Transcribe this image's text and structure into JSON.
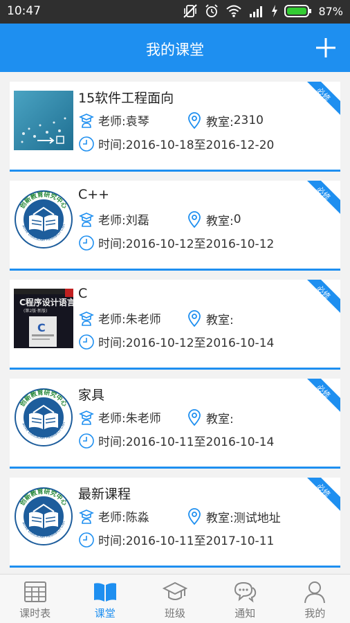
{
  "status_bar": {
    "time": "10:47",
    "battery": "87%"
  },
  "header": {
    "title": "我的课堂",
    "add_icon": "plus-icon"
  },
  "labels": {
    "teacher": "老师: ",
    "room": "教室: ",
    "time": "时间: "
  },
  "courses": [
    {
      "title": "15软件工程面向",
      "teacher": "袁琴",
      "room": "2310",
      "period": "2016-10-18至2016-12-20",
      "badge": "必修",
      "thumb": "photo-cover"
    },
    {
      "title": "C++",
      "teacher": "刘磊",
      "room": "0",
      "period": "2016-10-12至2016-10-12",
      "badge": "必修",
      "thumb": "institute-logo"
    },
    {
      "title": "C",
      "teacher": "朱老师",
      "room": "",
      "period": "2016-10-12至2016-10-14",
      "badge": "必修",
      "thumb": "book-cover"
    },
    {
      "title": "家具",
      "teacher": "朱老师",
      "room": "",
      "period": "2016-10-11至2016-10-14",
      "badge": "必修",
      "thumb": "institute-logo"
    },
    {
      "title": "最新课程",
      "teacher": "陈淼",
      "room": "测试地址",
      "period": "2016-10-11至2017-10-11",
      "badge": "必修",
      "thumb": "institute-logo"
    }
  ],
  "logo_text": {
    "top": "创新教育研究中心",
    "bottom": "Creative Education Research Center"
  },
  "book_cover": {
    "title": "C程序设计语言",
    "subtitle": "(第2版·新版)"
  },
  "nav": {
    "items": [
      {
        "label": "课时表",
        "icon": "timetable-icon"
      },
      {
        "label": "课堂",
        "icon": "open-book-icon"
      },
      {
        "label": "班级",
        "icon": "graduation-cap-icon"
      },
      {
        "label": "通知",
        "icon": "chat-bubbles-icon"
      },
      {
        "label": "我的",
        "icon": "person-icon"
      }
    ],
    "active_index": 1
  },
  "colors": {
    "primary": "#1e8ff0",
    "status_bar": "#2f2f2f",
    "battery": "#33cc33",
    "text": "#333333",
    "inactive": "#777777"
  }
}
